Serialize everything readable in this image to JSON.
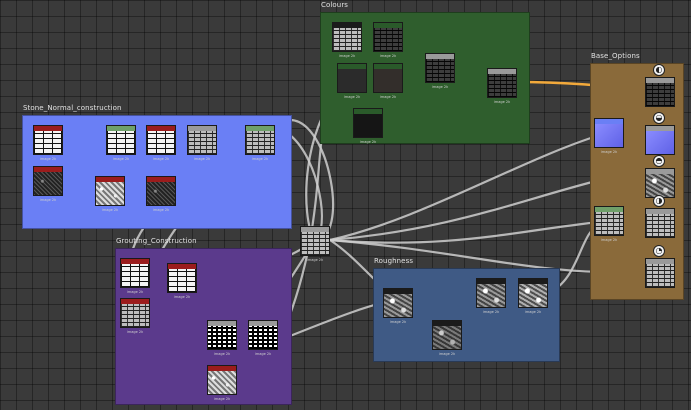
{
  "frames": {
    "colours": {
      "title": "Colours",
      "color": "#2f5e2d"
    },
    "stone_normal": {
      "title": "Stone_Normal_construction",
      "color": "#6a7ff5"
    },
    "grouting": {
      "title": "Grouting_Construction",
      "color": "#5b3a8c"
    },
    "roughness": {
      "title": "Roughness",
      "color": "#3f5a85"
    },
    "base_options": {
      "title": "Base_Options",
      "color": "#8a6a3a"
    }
  },
  "node_caption": "image 2k",
  "output_icons": [
    "gamma-icon",
    "normal-icon",
    "roughness-icon",
    "metallic-icon",
    "height-icon"
  ]
}
